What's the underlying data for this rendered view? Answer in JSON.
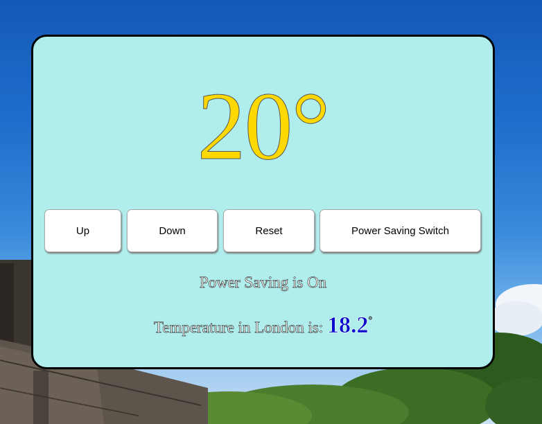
{
  "thermostat": {
    "temperature": "20°"
  },
  "controls": {
    "up_label": "Up",
    "down_label": "Down",
    "reset_label": "Reset",
    "power_saving_label": "Power Saving Switch"
  },
  "status": {
    "power_saving_text": "Power Saving is On"
  },
  "weather": {
    "prefix": "Temperature in London is: ",
    "value": "18.2",
    "unit": "°"
  },
  "colors": {
    "card_background": "#b0eeee",
    "temperature_color": "#ffd800",
    "city_temp_color": "#0a0acc"
  }
}
